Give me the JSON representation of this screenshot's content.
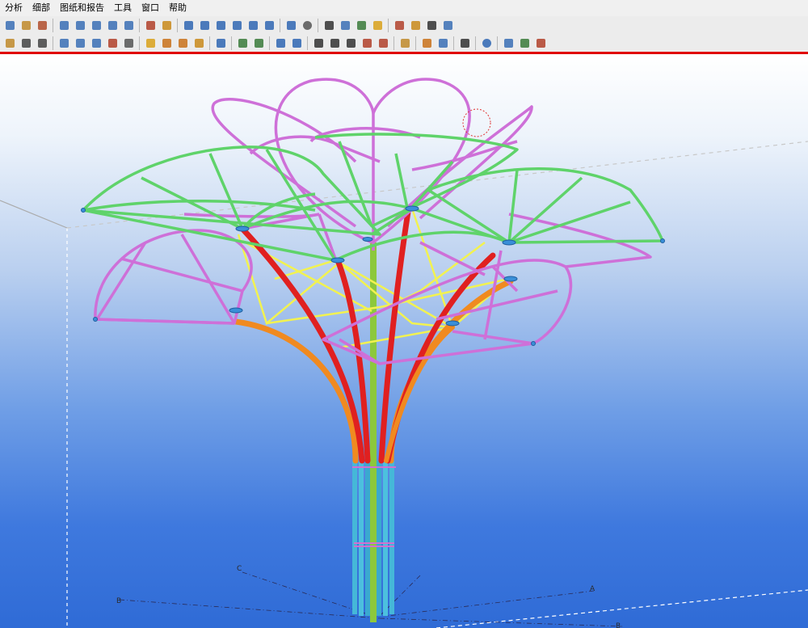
{
  "menu": [
    "分析",
    "细部",
    "图纸和报告",
    "工具",
    "窗口",
    "帮助"
  ],
  "toolbar1": {
    "groups": [
      [
        {
          "icon": "undo-icon",
          "color": "#3a6fb5"
        },
        {
          "icon": "hand-icon",
          "color": "#c08a2a"
        },
        {
          "icon": "snap-icon",
          "color": "#b04d2d"
        }
      ],
      [
        {
          "icon": "column-icon",
          "color": "#3a6fb5"
        },
        {
          "icon": "beam-icon",
          "color": "#3a6fb5"
        },
        {
          "icon": "panel-icon",
          "color": "#3a6fb5"
        },
        {
          "icon": "brace-icon",
          "color": "#3a6fb5"
        },
        {
          "icon": "twin-beam-icon",
          "color": "#3a6fb5"
        }
      ],
      [
        {
          "icon": "bolt-icon",
          "color": "#b2412a"
        },
        {
          "icon": "weld-icon",
          "color": "#c98a1b"
        }
      ],
      [
        {
          "icon": "line-icon",
          "color": "#2f66b3"
        },
        {
          "icon": "part-icon",
          "color": "#2f66b3"
        },
        {
          "icon": "part-icon",
          "color": "#2f66b3"
        },
        {
          "icon": "cut-icon",
          "color": "#2f66b3"
        },
        {
          "icon": "cross-icon",
          "color": "#2f66b3"
        },
        {
          "icon": "point-icon",
          "color": "#2f66b3"
        }
      ],
      [
        {
          "icon": "measure-icon",
          "color": "#2f66b3"
        },
        {
          "icon": "circle-icon",
          "color": "#555555"
        }
      ],
      [
        {
          "icon": "view-icon",
          "color": "#333333"
        },
        {
          "icon": "plane-icon",
          "color": "#3a6fb5"
        },
        {
          "icon": "tree-icon",
          "color": "#3a7a3a"
        },
        {
          "icon": "box-icon",
          "color": "#d9a11a"
        }
      ],
      [
        {
          "icon": "pen-icon",
          "color": "#b2412a"
        },
        {
          "icon": "brush-icon",
          "color": "#c98a1b"
        },
        {
          "icon": "stamp-icon",
          "color": "#333333"
        },
        {
          "icon": "copy-icon",
          "color": "#3a6fb5"
        }
      ]
    ]
  },
  "toolbar2": {
    "groups": [
      [
        {
          "icon": "rotate-icon",
          "color": "#c08a2a"
        },
        {
          "icon": "print-icon",
          "color": "#444444"
        },
        {
          "icon": "page-icon",
          "color": "#444444"
        }
      ],
      [
        {
          "icon": "frame-icon",
          "color": "#3a6fb5"
        },
        {
          "icon": "frame-icon",
          "color": "#3a6fb5"
        },
        {
          "icon": "frame-icon",
          "color": "#3a6fb5"
        },
        {
          "icon": "scissors-icon",
          "color": "#b2412a"
        },
        {
          "icon": "select-icon",
          "color": "#555555"
        }
      ],
      [
        {
          "icon": "cube-icon",
          "color": "#d9a11a"
        },
        {
          "icon": "cube-icon",
          "color": "#c9711a"
        },
        {
          "icon": "assembly-icon",
          "color": "#c9711a"
        },
        {
          "icon": "drawing-icon",
          "color": "#c98a1b"
        }
      ],
      [
        {
          "icon": "arrow-icon",
          "color": "#2f66b3"
        }
      ],
      [
        {
          "icon": "filter-icon",
          "color": "#3a7a3a"
        },
        {
          "icon": "filter-icon",
          "color": "#3a7a3a"
        }
      ],
      [
        {
          "icon": "help-icon",
          "color": "#2f66b3"
        },
        {
          "icon": "inquire-icon",
          "color": "#2f66b3"
        }
      ],
      [
        {
          "icon": "grid-icon",
          "color": "#333333"
        },
        {
          "icon": "grid-icon",
          "color": "#333333"
        },
        {
          "icon": "move-icon",
          "color": "#333333"
        },
        {
          "icon": "scale-icon",
          "color": "#b2412a"
        },
        {
          "icon": "flag-icon",
          "color": "#b2412a"
        }
      ],
      [
        {
          "icon": "pin-icon",
          "color": "#c08a2a"
        }
      ],
      [
        {
          "icon": "layer-icon",
          "color": "#c9711a"
        },
        {
          "icon": "report-icon",
          "color": "#3a6fb5"
        }
      ],
      [
        {
          "icon": "numbering-icon",
          "color": "#333333"
        }
      ],
      [
        {
          "icon": "globe-icon",
          "color": "#2f66b3"
        }
      ],
      [
        {
          "icon": "forward-icon",
          "color": "#3a6fb5"
        },
        {
          "icon": "clash-icon",
          "color": "#3a7a3a"
        },
        {
          "icon": "export-icon",
          "color": "#b2412a"
        }
      ]
    ]
  },
  "grid_labels": [
    "C",
    "B",
    "A",
    "B"
  ],
  "colors": {
    "accent_red": "#e00000",
    "top_bars": "#ce70d8",
    "mid_bars": "#5fd36a",
    "trunk_red": "#e02020",
    "trunk_orange": "#f08a20",
    "braces": "#f2f250",
    "trunk_base": "#45b8d8",
    "column_core": "#9bd030"
  }
}
